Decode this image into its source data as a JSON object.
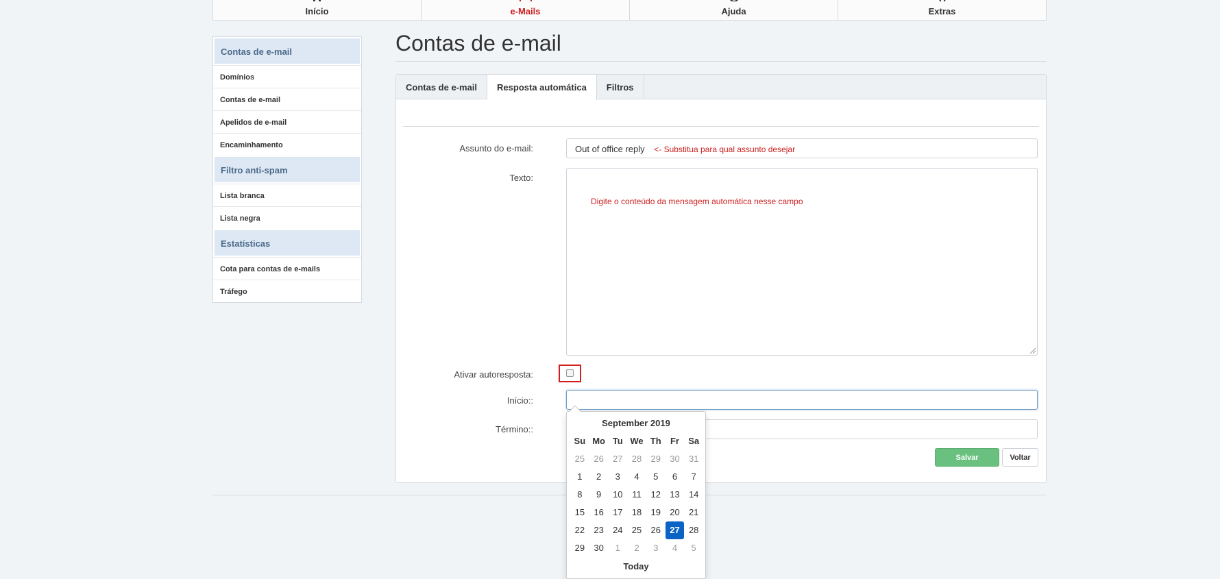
{
  "nav": [
    {
      "label": "Início",
      "icon": "home-icon",
      "active": false
    },
    {
      "label": "e-Mails",
      "icon": "mail-icon",
      "active": true
    },
    {
      "label": "Ajuda",
      "icon": "help-icon",
      "active": false
    },
    {
      "label": "Extras",
      "icon": "extras-icon",
      "active": false
    }
  ],
  "sidebar": {
    "sections": [
      {
        "header": "Contas de e-mail",
        "items": [
          "Domínios",
          "Contas de e-mail",
          "Apelidos de e-mail",
          "Encaminhamento"
        ]
      },
      {
        "header": "Filtro anti-spam",
        "items": [
          "Lista branca",
          "Lista negra"
        ]
      },
      {
        "header": "Estatísticas",
        "items": [
          "Cota para contas de e-mails",
          "Tráfego"
        ]
      }
    ]
  },
  "page_title": "Contas de e-mail",
  "tabs": [
    {
      "label": "Contas de e-mail",
      "active": false
    },
    {
      "label": "Resposta automática",
      "active": true
    },
    {
      "label": "Filtros",
      "active": false
    }
  ],
  "form": {
    "subject_label": "Assunto do e-mail:",
    "subject_value": "Out of office reply",
    "subject_note": "<- Substitua para qual assunto desejar",
    "text_label": "Texto:",
    "text_note": "Digite o conteúdo da mensagem automática nesse campo",
    "activate_label": "Ativar autoresposta:",
    "activate_checked": false,
    "start_label": "Início::",
    "start_value": "",
    "end_label": "Término::",
    "end_value": "",
    "save_label": "Salvar",
    "back_label": "Voltar"
  },
  "colors": {
    "accent_red": "#cc1f1f",
    "save_green": "#6ac07f",
    "selected_blue": "#0b63c6",
    "sidebar_header_bg": "#dde8f4"
  },
  "datepicker": {
    "title": "September 2019",
    "weekdays": [
      "Su",
      "Mo",
      "Tu",
      "We",
      "Th",
      "Fr",
      "Sa"
    ],
    "weeks": [
      [
        {
          "d": "25",
          "m": true
        },
        {
          "d": "26",
          "m": true
        },
        {
          "d": "27",
          "m": true
        },
        {
          "d": "28",
          "m": true
        },
        {
          "d": "29",
          "m": true
        },
        {
          "d": "30",
          "m": true
        },
        {
          "d": "31",
          "m": true
        }
      ],
      [
        {
          "d": "1"
        },
        {
          "d": "2"
        },
        {
          "d": "3"
        },
        {
          "d": "4"
        },
        {
          "d": "5"
        },
        {
          "d": "6"
        },
        {
          "d": "7"
        }
      ],
      [
        {
          "d": "8"
        },
        {
          "d": "9"
        },
        {
          "d": "10"
        },
        {
          "d": "11"
        },
        {
          "d": "12"
        },
        {
          "d": "13"
        },
        {
          "d": "14"
        }
      ],
      [
        {
          "d": "15"
        },
        {
          "d": "16"
        },
        {
          "d": "17"
        },
        {
          "d": "18"
        },
        {
          "d": "19"
        },
        {
          "d": "20"
        },
        {
          "d": "21"
        }
      ],
      [
        {
          "d": "22"
        },
        {
          "d": "23"
        },
        {
          "d": "24"
        },
        {
          "d": "25"
        },
        {
          "d": "26"
        },
        {
          "d": "27",
          "sel": true
        },
        {
          "d": "28"
        }
      ],
      [
        {
          "d": "29"
        },
        {
          "d": "30"
        },
        {
          "d": "1",
          "m": true
        },
        {
          "d": "2",
          "m": true
        },
        {
          "d": "3",
          "m": true
        },
        {
          "d": "4",
          "m": true
        },
        {
          "d": "5",
          "m": true
        }
      ]
    ],
    "today_label": "Today"
  }
}
